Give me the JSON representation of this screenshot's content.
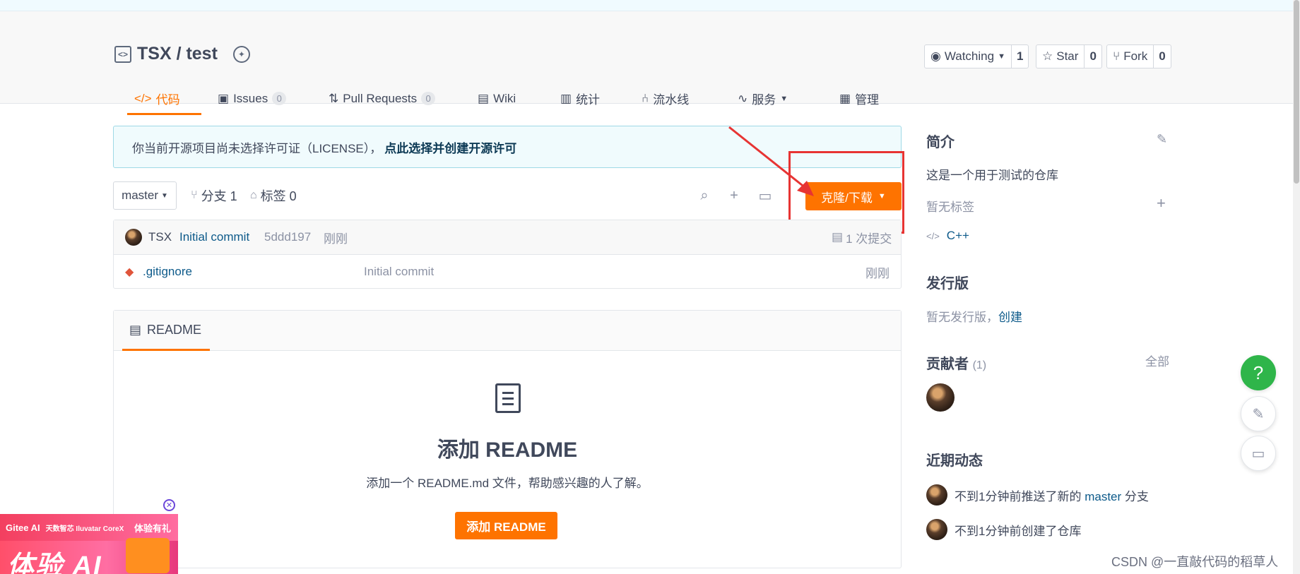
{
  "repo": {
    "title": "TSX / test"
  },
  "actions": {
    "watching": {
      "label": "Watching",
      "count": "1"
    },
    "star": {
      "label": "Star",
      "count": "0"
    },
    "fork": {
      "label": "Fork",
      "count": "0"
    }
  },
  "tabs": [
    {
      "label": "代码",
      "icon": "code-icon",
      "active": true
    },
    {
      "label": "Issues",
      "count": "0",
      "icon": "issues-icon"
    },
    {
      "label": "Pull Requests",
      "count": "0",
      "icon": "pull-request-icon"
    },
    {
      "label": "Wiki",
      "icon": "wiki-icon"
    },
    {
      "label": "统计",
      "icon": "stats-icon"
    },
    {
      "label": "流水线",
      "icon": "pipeline-icon"
    },
    {
      "label": "服务",
      "icon": "service-icon"
    },
    {
      "label": "管理",
      "icon": "manage-icon"
    }
  ],
  "notice": {
    "text": "你当前开源项目尚未选择许可证（LICENSE），",
    "link": "点此选择并创建开源许可"
  },
  "branch": {
    "current": "master",
    "branches": "分支 1",
    "tags": "标签 0"
  },
  "clone_button": "克隆/下载",
  "commit": {
    "author": "TSX",
    "message": "Initial commit",
    "hash": "5ddd197",
    "time": "刚刚",
    "count": "1 次提交"
  },
  "files": [
    {
      "name": ".gitignore",
      "message": "Initial commit",
      "time": "刚刚"
    }
  ],
  "readme": {
    "tab": "README",
    "title": "添加 README",
    "desc": "添加一个 README.md 文件，帮助感兴趣的人了解。",
    "button": "添加 README"
  },
  "sidebar": {
    "intro_title": "简介",
    "intro_text": "这是一个用于测试的仓库",
    "no_tags": "暂无标签",
    "language": "C++",
    "release_title": "发行版",
    "release_text": "暂无发行版，",
    "release_create": "创建",
    "contributors_title": "贡献者",
    "contributors_count": "(1)",
    "contributors_all": "全部",
    "activity_title": "近期动态",
    "activity": [
      {
        "text_pre": "不到1分钟前推送了新的",
        "branch": "master",
        "text_post": "分支"
      },
      {
        "text_pre": "不到1分钟前创建了仓库"
      }
    ]
  },
  "ad": {
    "brand": "Gitee AI",
    "partner": "天数智芯 Iluvatar CoreX",
    "badge": "体验有礼",
    "big": "体验 AI"
  },
  "watermark": "CSDN @一直敲代码的稻草人",
  "colors": {
    "accent": "#fe7300",
    "highlight": "#e73433",
    "help": "#2fb54a"
  }
}
